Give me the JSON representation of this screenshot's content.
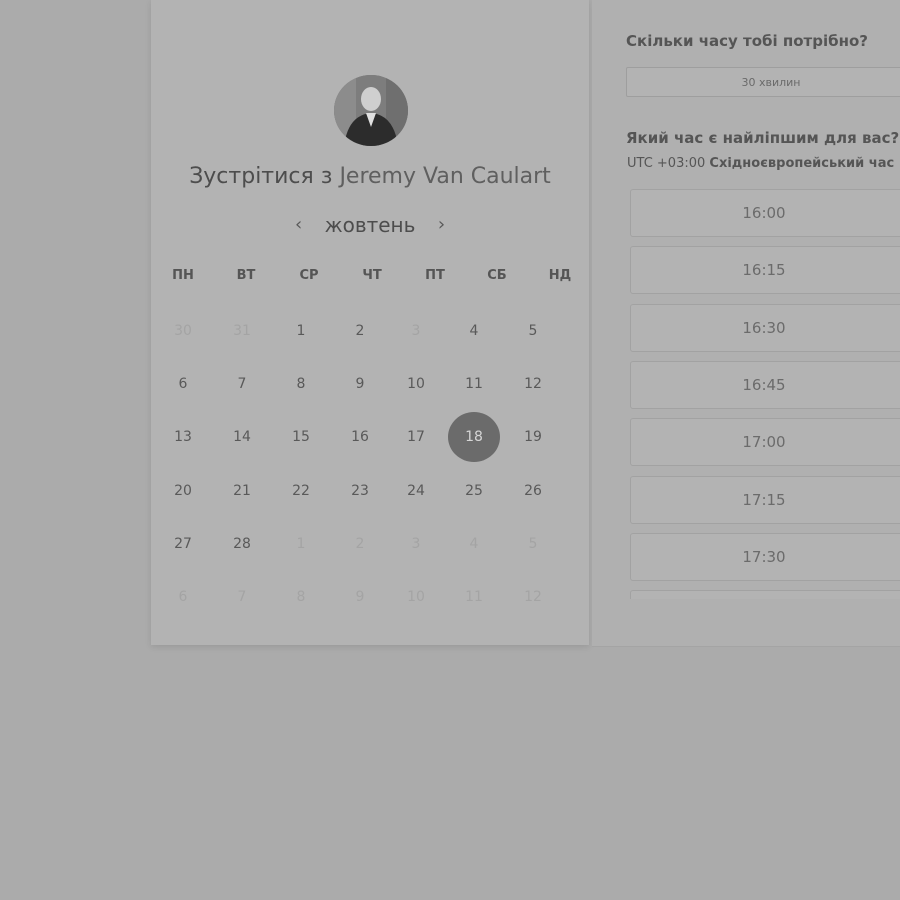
{
  "calendar": {
    "avatar_icon": "person-photo",
    "title_prefix": "Зустрітися з",
    "host_name": "Jeremy Van Caulart",
    "month": "жовтень",
    "prev_icon": "‹",
    "next_icon": "›",
    "weekdays": [
      "ПН",
      "ВТ",
      "СР",
      "ЧТ",
      "ПТ",
      "СБ",
      "НД"
    ],
    "weeks": [
      [
        "30",
        "31",
        "1",
        "2",
        "3",
        "4",
        "5"
      ],
      [
        "6",
        "7",
        "8",
        "9",
        "10",
        "11",
        "12"
      ],
      [
        "13",
        "14",
        "15",
        "16",
        "17",
        "18",
        "19"
      ],
      [
        "20",
        "21",
        "22",
        "23",
        "24",
        "25",
        "26"
      ],
      [
        "27",
        "28",
        "1",
        "2",
        "3",
        "4",
        "5"
      ],
      [
        "6",
        "7",
        "8",
        "9",
        "10",
        "11",
        "12"
      ]
    ],
    "muted": [
      [
        true,
        true,
        false,
        false,
        true,
        false,
        false
      ],
      [
        false,
        false,
        false,
        false,
        false,
        false,
        false
      ],
      [
        false,
        false,
        false,
        false,
        false,
        false,
        false
      ],
      [
        false,
        false,
        false,
        false,
        false,
        false,
        false
      ],
      [
        false,
        false,
        true,
        true,
        true,
        true,
        true
      ],
      [
        true,
        true,
        true,
        true,
        true,
        true,
        true
      ]
    ],
    "selected_day": "18"
  },
  "booking": {
    "duration_question": "Скільки часу тобі потрібно?",
    "duration_value": "30 хвилин",
    "time_question": "Який час є найліпшим для вас?",
    "timezone_offset": "UTC +03:00",
    "timezone_name": "Східноєвропейський час",
    "slots": [
      "16:00",
      "16:15",
      "16:30",
      "16:45",
      "17:00",
      "17:15",
      "17:30",
      ""
    ]
  },
  "colors": {
    "selected_day_bg": "#6b6b6b",
    "page_bg": "#ababab"
  }
}
